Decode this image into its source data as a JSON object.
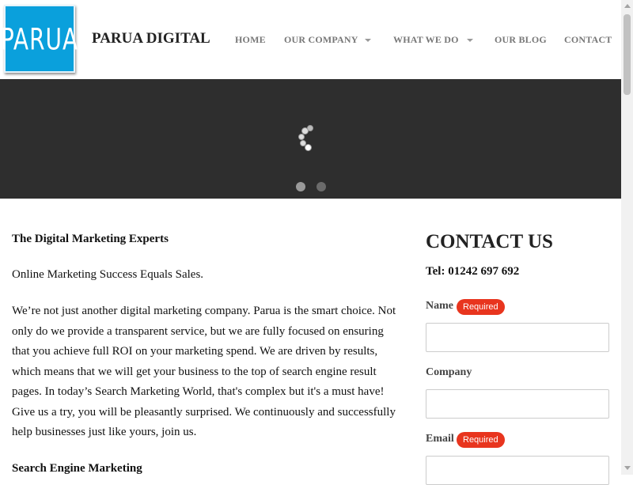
{
  "header": {
    "logo_text": "PARUA",
    "site_name": "PARUA DIGITAL",
    "nav": [
      {
        "label": "HOME",
        "has_dropdown": false
      },
      {
        "label": "OUR COMPANY",
        "has_dropdown": true
      },
      {
        "label": "WHAT WE DO",
        "has_dropdown": true
      },
      {
        "label": "OUR BLOG",
        "has_dropdown": false
      },
      {
        "label": "CONTACT",
        "has_dropdown": false
      }
    ]
  },
  "hero": {
    "slides": 2,
    "active_slide": 1,
    "loading": true
  },
  "main": {
    "heading": "The Digital Marketing Experts",
    "tagline": "Online Marketing Success Equals Sales.",
    "body_lines": [
      "We’re not just another digital marketing company. Parua is the smart choice. Not",
      "only do we provide a transparent service, but we are fully focused on ensuring",
      "that you achieve full ROI on your marketing spend. We are driven by results,",
      "which means that we will get your business to the top of search engine result",
      "pages. In today’s Search Marketing World, that's complex but it's a must have!",
      "Give us a try, you will be pleasantly surprised. We continuously and successfully",
      "help businesses just like yours, join us."
    ],
    "subheading": "Search Engine Marketing"
  },
  "contact": {
    "title": "CONTACT US",
    "tel": "Tel: 01242 697 692",
    "fields": [
      {
        "label": "Name",
        "required": true,
        "badge": "Required",
        "value": ""
      },
      {
        "label": "Company",
        "required": false,
        "badge": "",
        "value": ""
      },
      {
        "label": "Email",
        "required": true,
        "badge": "Required",
        "value": ""
      }
    ]
  },
  "colors": {
    "logo_blue": "#0aa0dc",
    "hero_bg": "#2e2e2e",
    "required_badge": "#e8351e",
    "nav_text": "#777777"
  },
  "icons": {
    "loading": "spinner-icon",
    "dropdown": "chevron-down-icon"
  }
}
